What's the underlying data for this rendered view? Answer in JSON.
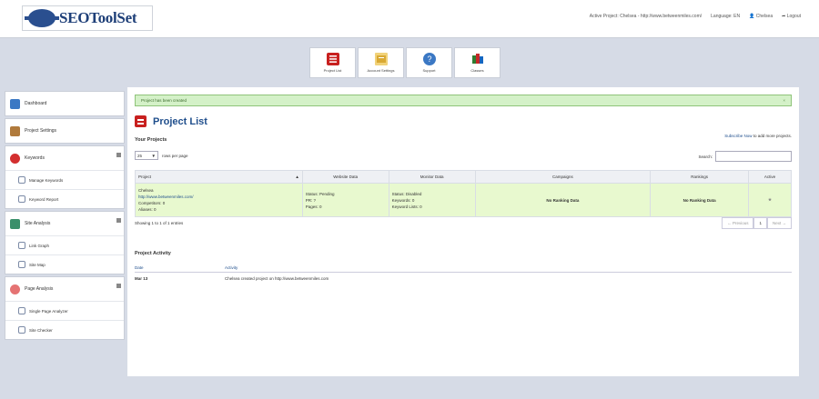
{
  "header": {
    "logo_text": "SEOToolSet",
    "active_project": "Active Project: Chelsea - http://www.betweenmiles.com/",
    "language": "Language: EN",
    "user": "Chelsea",
    "logout": "Logout"
  },
  "toolbar": {
    "items": [
      {
        "label": "Project List"
      },
      {
        "label": "Account Settings"
      },
      {
        "label": "Support"
      },
      {
        "label": "Classes"
      }
    ]
  },
  "sidebar": {
    "dashboard": "Dashboard",
    "project_settings": "Project Settings",
    "keywords": "Keywords",
    "manage_keywords": "Manage Keywords",
    "keyword_report": "Keyword Report",
    "site_analysis": "Site Analysis",
    "link_graph": "Link Graph",
    "site_map": "Site Map",
    "page_analysis": "Page Analysis",
    "single_page_analyzer": "Single Page Analyzer",
    "site_checker": "Site Checker"
  },
  "main": {
    "alert": "Project has been created",
    "alert_close": "×",
    "title": "Project List",
    "your_projects": "Your Projects",
    "subscribe_link": "Subscribe Now",
    "subscribe_rest": " to add more projects.",
    "rows_value": "25",
    "rows_label": "rows per page",
    "search_label": "Search:",
    "columns": [
      "Project",
      "Website Data",
      "Monitor Data",
      "Campaigns",
      "Rankings",
      "Active"
    ],
    "row": {
      "name": "Chelsea",
      "url": "http://www.betweenmiles.com/",
      "competitors": "Competitors: 0",
      "aliases": "Aliases: 0",
      "status": "Status: Pending",
      "pr": "PR: ?",
      "pages": "Pages: 0",
      "monitor_status": "Status: Disabled",
      "monitor_keywords": "Keywords: 0",
      "keyword_lists": "Keyword Lists: 0",
      "campaigns": "No Ranking Data",
      "rankings": "No Ranking Data",
      "active": "★"
    },
    "showing": "Showing 1 to 1 of 1 entries",
    "pager": {
      "prev": "← Previous",
      "page": "1",
      "next": "Next →"
    }
  },
  "activity": {
    "title": "Project Activity",
    "date_header": "Date",
    "activity_header": "Activity",
    "date": "Mar 13",
    "text": "Chelsea created project on http://www.betweenmiles.com"
  }
}
